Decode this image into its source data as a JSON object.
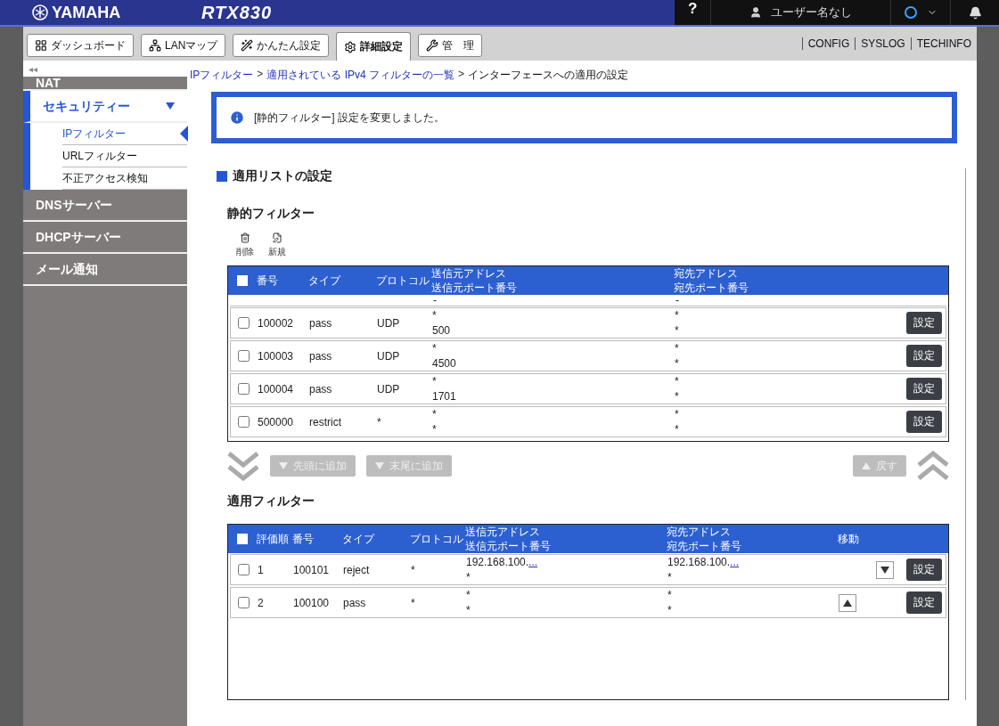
{
  "header": {
    "brand": "YAMAHA",
    "model": "RTX830",
    "help": "?",
    "user": "ユーザー名なし"
  },
  "nav_tabs": [
    {
      "label": "ダッシュボード",
      "selected": false
    },
    {
      "label": "LANマップ",
      "selected": false
    },
    {
      "label": "かんたん設定",
      "selected": false
    },
    {
      "label": "詳細設定",
      "selected": true
    },
    {
      "label": "管　理",
      "selected": false
    }
  ],
  "top_links": [
    "CONFIG",
    "SYSLOG",
    "TECHINFO"
  ],
  "sidebar": {
    "collapse": "◂◂",
    "items": [
      {
        "label": "NAT",
        "expanded": false
      },
      {
        "label": "セキュリティー",
        "expanded": true,
        "children": [
          {
            "label": "IPフィルター",
            "selected": true
          },
          {
            "label": "URLフィルター",
            "selected": false
          },
          {
            "label": "不正アクセス検知",
            "selected": false
          }
        ]
      },
      {
        "label": "DNSサーバー",
        "expanded": false
      },
      {
        "label": "DHCPサーバー",
        "expanded": false
      },
      {
        "label": "メール通知",
        "expanded": false
      }
    ]
  },
  "breadcrumbs": [
    {
      "label": "IPフィルター",
      "link": true
    },
    {
      "separator": ">",
      "label": "適用されている IPv4 フィルターの一覧",
      "link": true
    },
    {
      "separator": ">",
      "label": "インターフェースへの適用の設定",
      "link": false
    }
  ],
  "notice": "[静的フィルター] 設定を変更しました。",
  "section_title": "適用リストの設定",
  "static_filters": {
    "title": "静的フィルター",
    "tools": [
      {
        "label": "削除"
      },
      {
        "label": "新規"
      }
    ],
    "all_checked": false,
    "columns": [
      "番号",
      "タイプ",
      "プロトコル",
      "送信元アドレス",
      "送信元ポート番号",
      "宛先アドレス",
      "宛先ポート番号"
    ],
    "partial_row": {
      "source_port": "-",
      "dest_port": "-"
    },
    "rows": [
      {
        "number": "100002",
        "type": "pass",
        "protocol": "UDP",
        "source": "*",
        "source_port": "500",
        "dest": "*",
        "dest_port": "*",
        "button": "設定",
        "checked": false
      },
      {
        "number": "100003",
        "type": "pass",
        "protocol": "UDP",
        "source": "*",
        "source_port": "4500",
        "dest": "*",
        "dest_port": "*",
        "button": "設定",
        "checked": false
      },
      {
        "number": "100004",
        "type": "pass",
        "protocol": "UDP",
        "source": "*",
        "source_port": "1701",
        "dest": "*",
        "dest_port": "*",
        "button": "設定",
        "checked": false
      },
      {
        "number": "500000",
        "type": "restrict",
        "protocol": "*",
        "source": "*",
        "source_port": "*",
        "dest": "*",
        "dest_port": "*",
        "button": "設定",
        "checked": false
      }
    ]
  },
  "transfer": {
    "add_top": "先頭に追加",
    "add_end": "末尾に追加",
    "undo": "戻す",
    "disabled": true
  },
  "applied_filters": {
    "title": "適用フィルター",
    "all_checked": false,
    "columns": [
      "評価順",
      "番号",
      "タイプ",
      "プロトコル",
      "送信元アドレス",
      "送信元ポート番号",
      "宛先アドレス",
      "宛先ポート番号",
      "移動"
    ],
    "rows": [
      {
        "order": "1",
        "number": "100101",
        "type": "reject",
        "protocol": "*",
        "source": "192.168.100.",
        "source_more": "...",
        "source_port": "*",
        "dest": "192.168.100.",
        "dest_more": "...",
        "dest_port": "*",
        "kind": "move-down",
        "button": "設定",
        "checked": false
      },
      {
        "order": "2",
        "number": "100100",
        "type": "pass",
        "protocol": "*",
        "source": "*",
        "source_port": "*",
        "dest": "*",
        "dest_port": "*",
        "kind": "move-up",
        "button": "設定",
        "checked": false
      }
    ]
  }
}
